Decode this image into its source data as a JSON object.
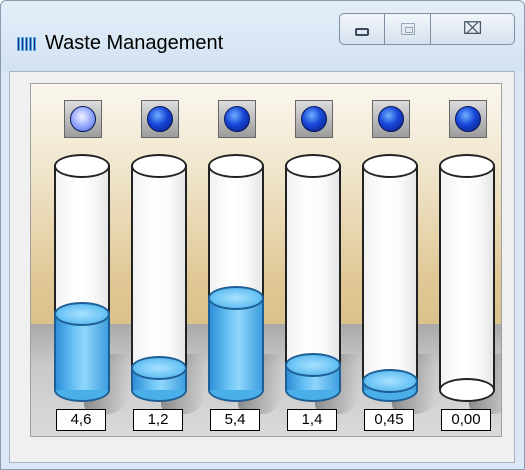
{
  "window": {
    "title": "Waste Management",
    "icon": "bar-meter-icon",
    "controls": {
      "minimize": "minimize-icon",
      "maximize": "maximize-icon",
      "close": "close-icon",
      "close_glyph": "⌧"
    }
  },
  "colors": {
    "liquid": "#5ab8ef",
    "lamp_off": "#1746d8",
    "lamp_on": "#aab8ff",
    "panel_gradient_top": "#fbf7ee",
    "panel_gradient_bottom": "#caa86a"
  },
  "containers": [
    {
      "lamp": "on",
      "value_text": "4,6",
      "fill_fraction": 0.34
    },
    {
      "lamp": "off",
      "value_text": "1,2",
      "fill_fraction": 0.1
    },
    {
      "lamp": "off",
      "value_text": "5,4",
      "fill_fraction": 0.41
    },
    {
      "lamp": "off",
      "value_text": "1,4",
      "fill_fraction": 0.11
    },
    {
      "lamp": "off",
      "value_text": "0,45",
      "fill_fraction": 0.04
    },
    {
      "lamp": "off",
      "value_text": "0,00",
      "fill_fraction": 0.0
    }
  ]
}
